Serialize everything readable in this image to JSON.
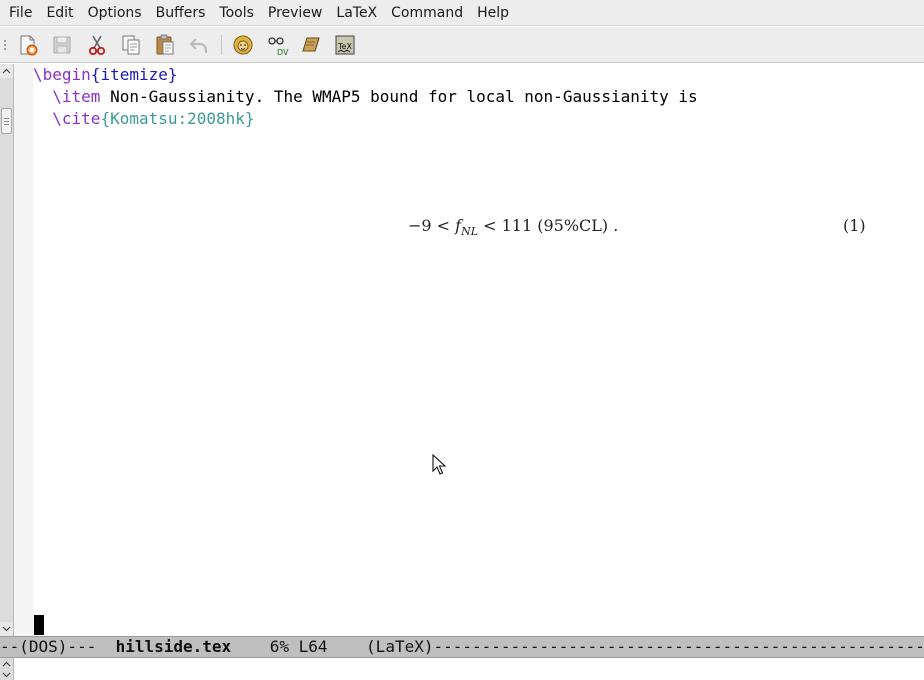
{
  "menubar": {
    "items": [
      "File",
      "Edit",
      "Options",
      "Buffers",
      "Tools",
      "Preview",
      "LaTeX",
      "Command",
      "Help"
    ]
  },
  "toolbar": {
    "icons": [
      "new-file-icon",
      "save-icon",
      "cut-icon",
      "copy-icon",
      "paste-icon",
      "undo-icon",
      "lion-latex-icon",
      "view-dvi-icon",
      "bibtex-book-icon",
      "tex-spell-icon"
    ],
    "dvi_label": "DV",
    "tex_label": "TeX"
  },
  "editor": {
    "line1": {
      "cmd": "\\begin",
      "brace_open": "{",
      "arg": "itemize",
      "brace_close": "}"
    },
    "line2": {
      "indent": "  ",
      "cmd": "\\item",
      "text": " Non-Gaussianity. The WMAP5 bound for local non-Gaussianity is"
    },
    "line3": {
      "indent": "  ",
      "cmd": "\\cite",
      "ref": "{Komatsu:2008hk}"
    },
    "equation": {
      "lhs": "−9 < ",
      "var": "f",
      "sub": "NL",
      "rhs": " < 111 (95%CL) .",
      "number": "(1)"
    }
  },
  "modeline": {
    "prefix": "--(DOS)---  ",
    "buffer_name": "hillside.tex",
    "position": "    6% L64    ",
    "mode": "(LaTeX)",
    "suffix": "------------------------------------------------------------------------"
  },
  "colors": {
    "keyword": "#8b2fc9",
    "argument": "#1b1bb5",
    "reference": "#3d9a9a"
  }
}
